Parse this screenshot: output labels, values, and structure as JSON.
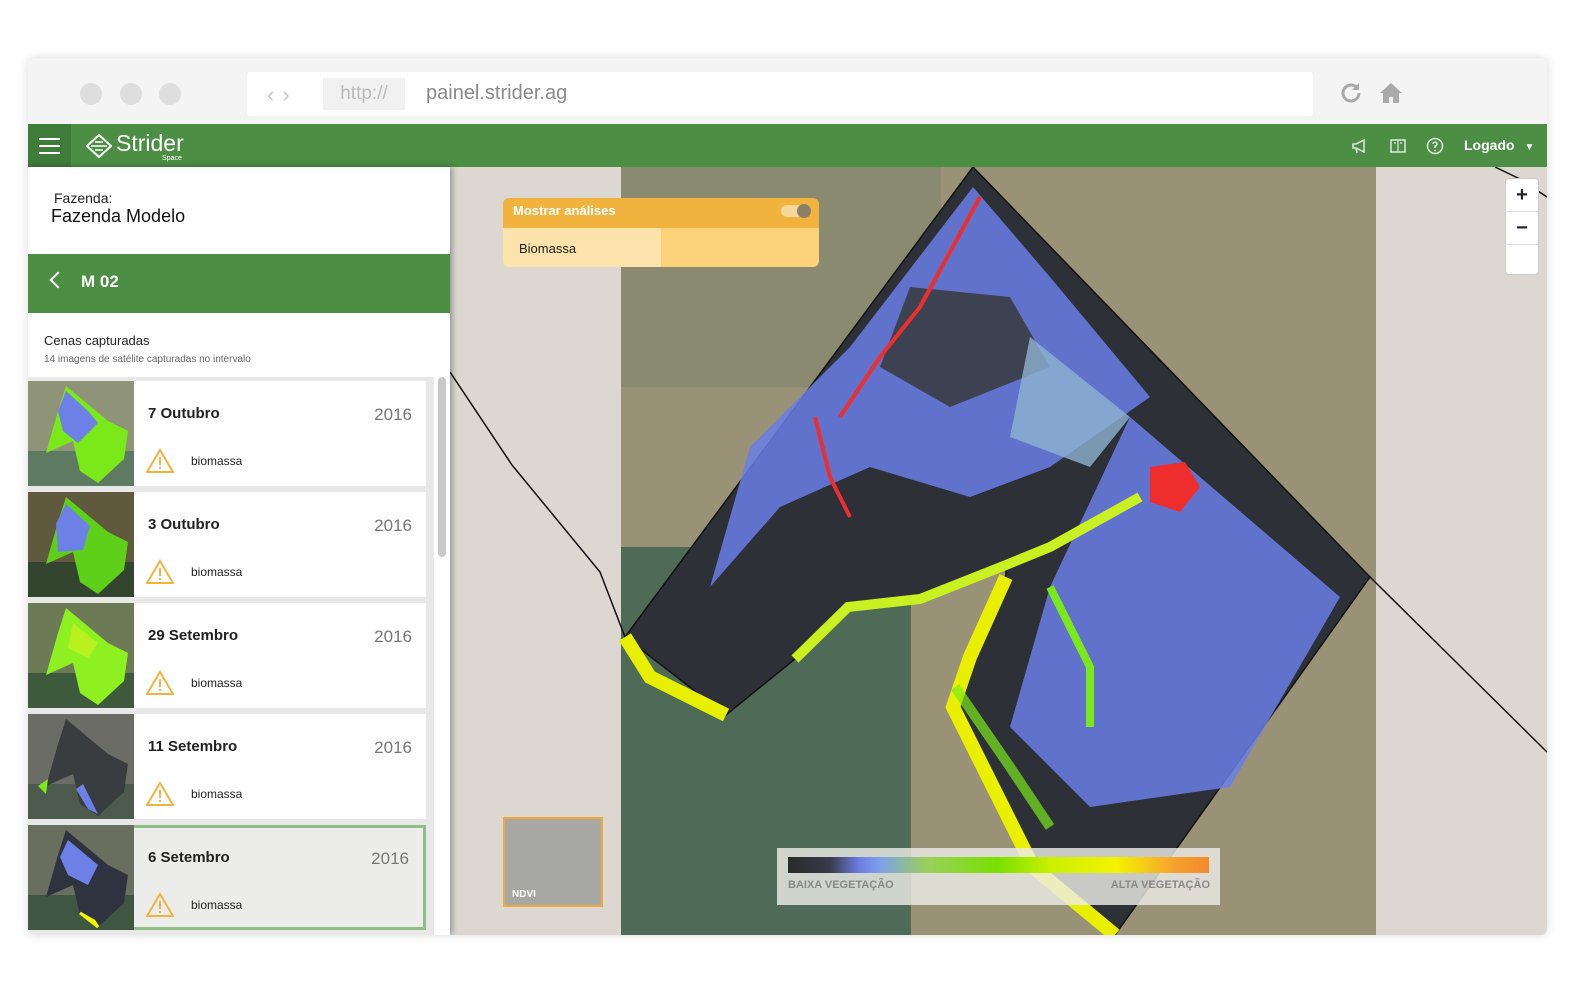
{
  "browser": {
    "url_protocol": "http://",
    "url": "painel.strider.ag"
  },
  "header": {
    "brand": "Strider",
    "brand_sub": "Space",
    "user_label": "Logado"
  },
  "farm": {
    "label": "Fazenda:",
    "name": "Fazenda Modelo"
  },
  "plot": {
    "name": "M 02"
  },
  "scenes": {
    "title": "Cenas capturadas",
    "subtitle": "14 imagens de satélite capturadas no intervalo",
    "items": [
      {
        "date": "7 Outubro",
        "year": "2016",
        "tag": "biomassa"
      },
      {
        "date": "3 Outubro",
        "year": "2016",
        "tag": "biomassa"
      },
      {
        "date": "29 Setembro",
        "year": "2016",
        "tag": "biomassa"
      },
      {
        "date": "11 Setembro",
        "year": "2016",
        "tag": "biomassa"
      },
      {
        "date": "6 Setembro",
        "year": "2016",
        "tag": "biomassa"
      }
    ]
  },
  "analysis_panel": {
    "title": "Mostrar análises",
    "toggle_on": true,
    "item": "Biomassa"
  },
  "zoom": {
    "plus": "+",
    "minus": "−"
  },
  "layer": {
    "label": "NDVI"
  },
  "legend": {
    "low": "BAIXA VEGETAÇÃO",
    "high": "ALTA VEGETAÇÃO"
  },
  "colors": {
    "brand_green": "#4b8e44",
    "accent_orange": "#f2b33e"
  }
}
